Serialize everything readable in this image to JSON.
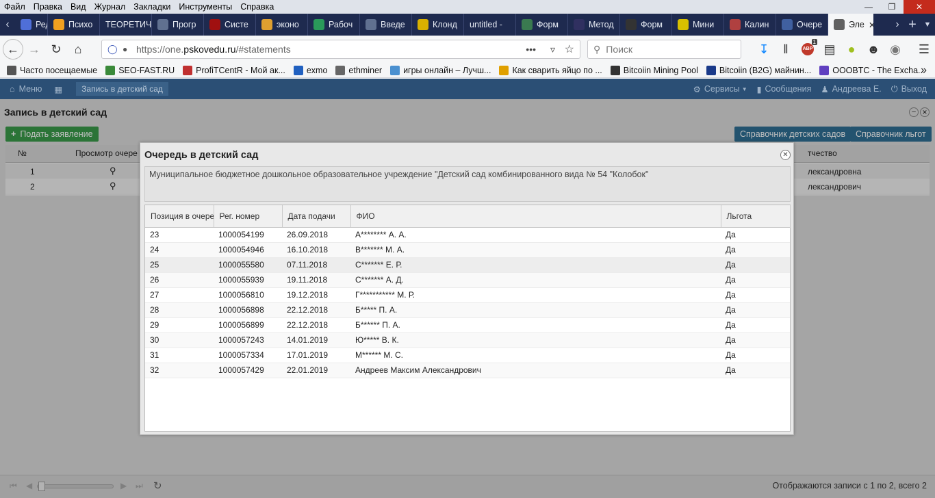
{
  "menubar": {
    "items": [
      "Файл",
      "Правка",
      "Вид",
      "Журнал",
      "Закладки",
      "Инструменты",
      "Справка"
    ]
  },
  "tabs": [
    {
      "label": "Редактор",
      "color": "#4f6fd8"
    },
    {
      "label": "Психо",
      "color": "#f0a020"
    },
    {
      "label": "ТЕОРЕТИЧ",
      "color": ""
    },
    {
      "label": "Прогр",
      "color": "#607090"
    },
    {
      "label": "Систе",
      "color": "#a01010"
    },
    {
      "label": "эконо",
      "color": "#e0a030"
    },
    {
      "label": "Рабоч",
      "color": "#2a9a5a"
    },
    {
      "label": "Введе",
      "color": "#607090"
    },
    {
      "label": "Клонд",
      "color": "#d8b000"
    },
    {
      "label": "untitled - ",
      "color": ""
    },
    {
      "label": "Форм",
      "color": "#3a7a50"
    },
    {
      "label": "Метод",
      "color": "#303060"
    },
    {
      "label": "Форм",
      "color": "#333"
    },
    {
      "label": "Мини",
      "color": "#d8c000"
    },
    {
      "label": "Калин",
      "color": "#b04040"
    },
    {
      "label": "Очере",
      "color": "#4060a0"
    },
    {
      "label": "Эле",
      "color": "#606060"
    }
  ],
  "address": {
    "prefix": "https://one.",
    "domain": "pskovedu.ru",
    "suffix": "/#statements"
  },
  "search": {
    "placeholder": "Поиск"
  },
  "bookmarks": [
    {
      "label": "Часто посещаемые",
      "color": "#555"
    },
    {
      "label": "SEO-FAST.RU",
      "color": "#3a8a3a"
    },
    {
      "label": "ProfiTCentR - Мой ак...",
      "color": "#c03030"
    },
    {
      "label": "exmo",
      "color": "#2060c0"
    },
    {
      "label": "ethminer",
      "color": "#666"
    },
    {
      "label": "игры онлайн – Лучш...",
      "color": "#4a90d0"
    },
    {
      "label": "Как сварить яйцо по ...",
      "color": "#e0a000"
    },
    {
      "label": "Bitcoiin Mining Pool",
      "color": "#333"
    },
    {
      "label": "Bitcoiin (B2G) майнин...",
      "color": "#1a3a8a"
    },
    {
      "label": "OOOBTC - The Excha...",
      "color": "#6040c0"
    }
  ],
  "addon_badge": "1",
  "app": {
    "menu_label": "Меню",
    "tab_label": "Запись в детский сад",
    "services": "Сервисы",
    "messages": "Сообщения",
    "user": "Андреева Е.",
    "logout": "Выход"
  },
  "panel": {
    "title": "Запись в детский сад",
    "submit_button": "Подать заявление",
    "kindergarten_ref": "Справочник детских садов",
    "benefits_ref": "Справочник льгот",
    "grid_headers": {
      "num": "№",
      "view": "Просмотр очере",
      "patronymic": "тчество"
    },
    "grid_rows": [
      {
        "num": "1",
        "patronymic": "лександровна"
      },
      {
        "num": "2",
        "patronymic": "лександрович"
      }
    ],
    "pager_status": "Отображаются записи с 1 по 2, всего 2"
  },
  "modal": {
    "title": "Очередь в детский сад",
    "org": "Муниципальное бюджетное дошкольное образовательное учреждение \"Детский сад комбинированного вида № 54 \"Колобок\"",
    "headers": {
      "pos": "Позиция в очереди",
      "reg": "Рег. номер",
      "date": "Дата подачи",
      "fio": "ФИО",
      "benefit": "Льгота"
    },
    "rows": [
      {
        "pos": "23",
        "reg": "1000054199",
        "date": "26.09.2018",
        "fio": "А******** А. А.",
        "benefit": "Да"
      },
      {
        "pos": "24",
        "reg": "1000054946",
        "date": "16.10.2018",
        "fio": "В******* М. А.",
        "benefit": "Да"
      },
      {
        "pos": "25",
        "reg": "1000055580",
        "date": "07.11.2018",
        "fio": "С******* Е. Р.",
        "benefit": "Да"
      },
      {
        "pos": "26",
        "reg": "1000055939",
        "date": "19.11.2018",
        "fio": "С******* А. Д.",
        "benefit": "Да"
      },
      {
        "pos": "27",
        "reg": "1000056810",
        "date": "19.12.2018",
        "fio": "Г*********** М. Р.",
        "benefit": "Да"
      },
      {
        "pos": "28",
        "reg": "1000056898",
        "date": "22.12.2018",
        "fio": "Б***** П. А.",
        "benefit": "Да"
      },
      {
        "pos": "29",
        "reg": "1000056899",
        "date": "22.12.2018",
        "fio": "Б****** П. А.",
        "benefit": "Да"
      },
      {
        "pos": "30",
        "reg": "1000057243",
        "date": "14.01.2019",
        "fio": "Ю***** В. К.",
        "benefit": "Да"
      },
      {
        "pos": "31",
        "reg": "1000057334",
        "date": "17.01.2019",
        "fio": "М****** М. С.",
        "benefit": "Да"
      },
      {
        "pos": "32",
        "reg": "1000057429",
        "date": "22.01.2019",
        "fio": "Андреев Максим Александрович",
        "benefit": "Да"
      }
    ]
  }
}
